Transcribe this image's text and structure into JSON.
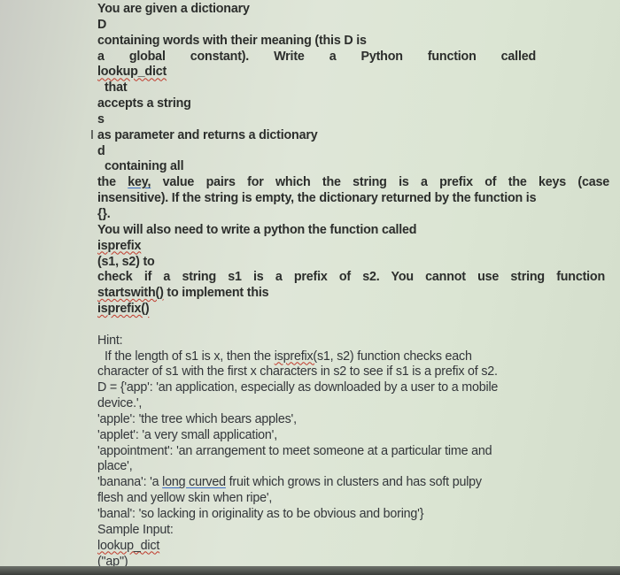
{
  "document": {
    "lines": [
      {
        "segments": [
          {
            "t": "You are given a dictionary"
          }
        ]
      },
      {
        "segments": [
          {
            "t": "D"
          }
        ]
      },
      {
        "segments": [
          {
            "t": "containing words with their meaning (this D is"
          }
        ]
      },
      {
        "justify": 495,
        "segments": [
          {
            "t": "a global constant). Write a Python function called"
          }
        ]
      },
      {
        "segments": [
          {
            "t": "lookup_dict",
            "u": "red"
          }
        ]
      },
      {
        "indent": true,
        "segments": [
          {
            "t": "that"
          }
        ]
      },
      {
        "segments": [
          {
            "t": "accepts a string"
          }
        ]
      },
      {
        "segments": [
          {
            "t": "s"
          }
        ]
      },
      {
        "cursor": true,
        "segments": [
          {
            "t": "as parameter and returns a dictionary"
          }
        ]
      },
      {
        "segments": [
          {
            "t": "d"
          }
        ]
      },
      {
        "indent": true,
        "segments": [
          {
            "t": "containing all"
          }
        ]
      },
      {
        "justify": 578,
        "segments": [
          {
            "t": "the "
          },
          {
            "t": "key,",
            "u": "blue"
          },
          {
            "t": "  value pairs for which the string is a prefix of the keys (case"
          }
        ]
      },
      {
        "segments": [
          {
            "t": "insensitive). If the string is empty, the dictionary returned by the function is"
          }
        ]
      },
      {
        "segments": [
          {
            "t": "{}."
          }
        ]
      },
      {
        "segments": [
          {
            "t": "You will also need to write a python the function called"
          }
        ]
      },
      {
        "segments": [
          {
            "t": "isprefix",
            "u": "red"
          }
        ]
      },
      {
        "segments": [
          {
            "t": "(s1, s2) to"
          }
        ]
      },
      {
        "justify": 573,
        "segments": [
          {
            "t": "check if a string s1 is a prefix of s2. You cannot use string function"
          }
        ]
      },
      {
        "segments": [
          {
            "t": "startswith()",
            "u": "red"
          },
          {
            "t": " to implement this"
          }
        ]
      },
      {
        "segments": [
          {
            "t": "isprefix()",
            "u": "red"
          }
        ]
      },
      {
        "segments": [
          {
            "t": ""
          }
        ]
      },
      {
        "light": true,
        "segments": [
          {
            "t": "Hint:"
          }
        ]
      },
      {
        "light": true,
        "indent": true,
        "segments": [
          {
            "t": "If the length of s1 is x, then the "
          },
          {
            "t": "isprefix(",
            "u": "red"
          },
          {
            "t": "s1, s2) function checks each"
          }
        ]
      },
      {
        "light": true,
        "segments": [
          {
            "t": "character of s1 with the first x characters in s2 to see if s1 is a prefix of s2."
          }
        ]
      },
      {
        "light": true,
        "segments": [
          {
            "t": "D = {'app': 'an application, especially as downloaded by a user to a mobile"
          }
        ]
      },
      {
        "light": true,
        "segments": [
          {
            "t": "device.',"
          }
        ]
      },
      {
        "light": true,
        "segments": [
          {
            "t": "'apple': 'the tree which bears apples',"
          }
        ]
      },
      {
        "light": true,
        "segments": [
          {
            "t": "'applet': 'a very small application',"
          }
        ]
      },
      {
        "light": true,
        "segments": [
          {
            "t": "'appointment': 'an arrangement to meet someone at a particular time and"
          }
        ]
      },
      {
        "light": true,
        "segments": [
          {
            "t": "place',"
          }
        ]
      },
      {
        "light": true,
        "segments": [
          {
            "t": "'banana': 'a "
          },
          {
            "t": "long curved",
            "u": "blue"
          },
          {
            "t": " fruit which grows in clusters and has soft pulpy"
          }
        ]
      },
      {
        "light": true,
        "segments": [
          {
            "t": "flesh and yellow skin when ripe',"
          }
        ]
      },
      {
        "light": true,
        "segments": [
          {
            "t": "'banal': 'so lacking in originality as to be obvious and boring'}"
          }
        ]
      },
      {
        "light": true,
        "segments": [
          {
            "t": "Sample Input:"
          }
        ]
      },
      {
        "light": true,
        "segments": [
          {
            "t": "lookup_dict",
            "u": "red"
          }
        ]
      },
      {
        "light": true,
        "segments": [
          {
            "t": "(\"ap\")"
          }
        ]
      }
    ]
  },
  "colors": {
    "text": "#2c2e2c",
    "spell_underline": "#c0392b",
    "grammar_underline": "#3a6bc4"
  }
}
